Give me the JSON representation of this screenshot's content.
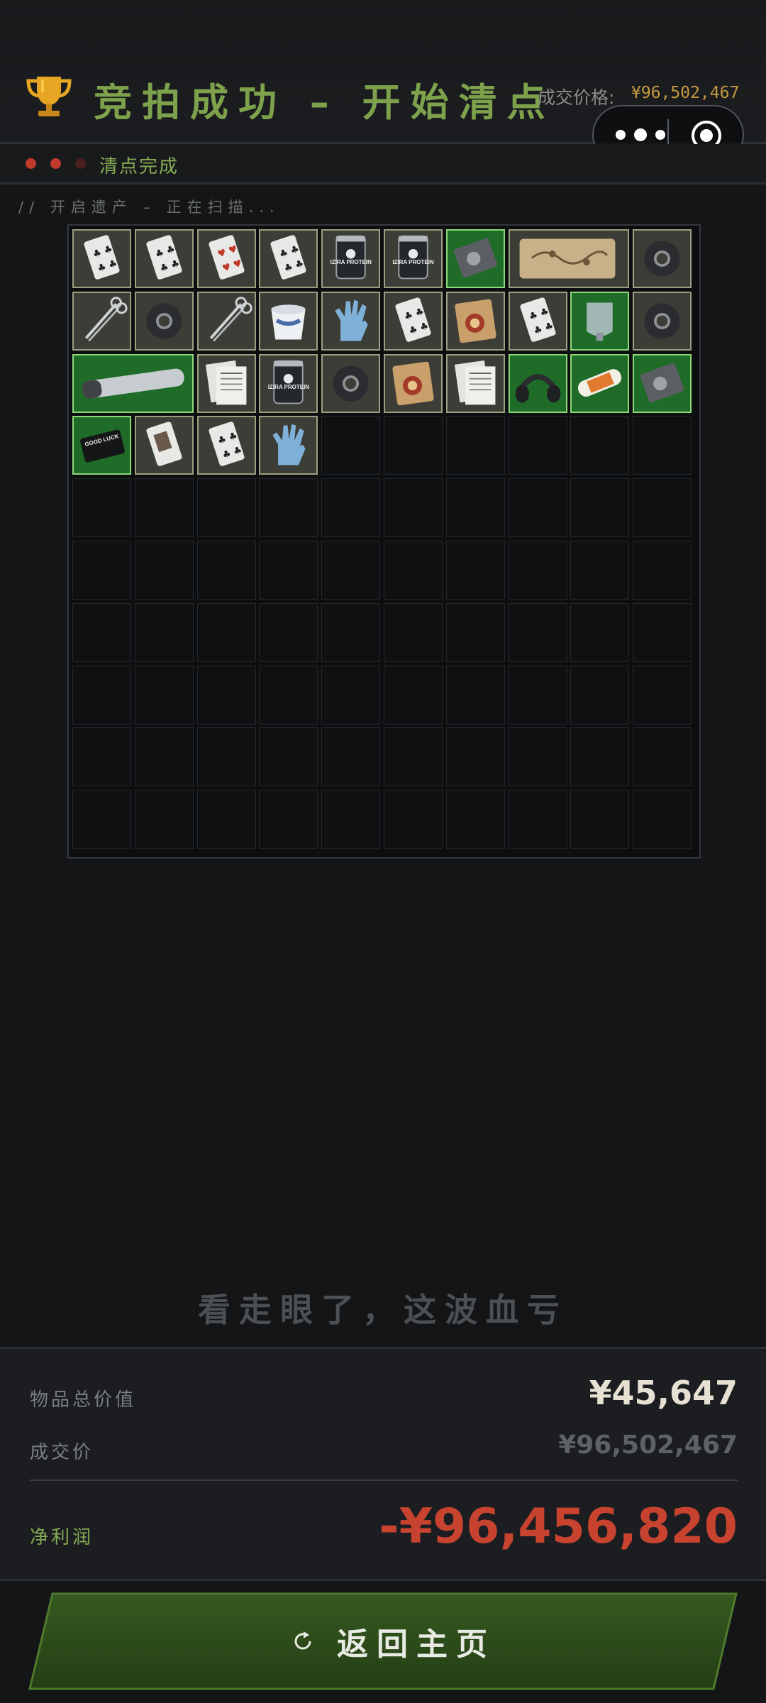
{
  "header": {
    "title": "竞拍成功 – 开始清点",
    "price_label": "成交价格:",
    "price_value": "¥96,502,467"
  },
  "status": {
    "text": "清点完成",
    "dots": 3
  },
  "scan": {
    "text": "// 开启遗产 – 正在扫描..."
  },
  "inventory": {
    "columns": 10,
    "rows": 10,
    "items": [
      {
        "name": "playing-card-clubs",
        "label": "",
        "row": 0,
        "col": 0,
        "w": 1,
        "h": 1,
        "rarity": "grey"
      },
      {
        "name": "playing-card-clubs",
        "label": "",
        "row": 0,
        "col": 1,
        "w": 1,
        "h": 1,
        "rarity": "grey"
      },
      {
        "name": "playing-card-hearts",
        "label": "",
        "row": 0,
        "col": 2,
        "w": 1,
        "h": 1,
        "rarity": "grey"
      },
      {
        "name": "playing-card-clubs",
        "label": "",
        "row": 0,
        "col": 3,
        "w": 1,
        "h": 1,
        "rarity": "grey"
      },
      {
        "name": "protein-can",
        "label": "IZIRA PROTEIN",
        "row": 0,
        "col": 4,
        "w": 1,
        "h": 1,
        "rarity": "grey"
      },
      {
        "name": "protein-can",
        "label": "IZIRA PROTEIN",
        "row": 0,
        "col": 5,
        "w": 1,
        "h": 1,
        "rarity": "grey"
      },
      {
        "name": "hard-drive",
        "label": "",
        "row": 0,
        "col": 6,
        "w": 1,
        "h": 1,
        "rarity": "green"
      },
      {
        "name": "old-map",
        "label": "",
        "row": 0,
        "col": 7,
        "w": 2,
        "h": 1,
        "rarity": "grey"
      },
      {
        "name": "duct-tape",
        "label": "",
        "row": 0,
        "col": 9,
        "w": 1,
        "h": 1,
        "rarity": "grey"
      },
      {
        "name": "surgical-scissors",
        "label": "",
        "row": 1,
        "col": 0,
        "w": 1,
        "h": 1,
        "rarity": "grey"
      },
      {
        "name": "duct-tape",
        "label": "",
        "row": 1,
        "col": 1,
        "w": 1,
        "h": 1,
        "rarity": "grey"
      },
      {
        "name": "surgical-scissors",
        "label": "",
        "row": 1,
        "col": 2,
        "w": 1,
        "h": 1,
        "rarity": "grey"
      },
      {
        "name": "yogurt-cup",
        "label": "",
        "row": 1,
        "col": 3,
        "w": 1,
        "h": 1,
        "rarity": "grey"
      },
      {
        "name": "medical-glove",
        "label": "",
        "row": 1,
        "col": 4,
        "w": 1,
        "h": 1,
        "rarity": "grey"
      },
      {
        "name": "playing-card-clubs",
        "label": "",
        "row": 1,
        "col": 5,
        "w": 1,
        "h": 1,
        "rarity": "grey"
      },
      {
        "name": "instant-noodles",
        "label": "",
        "row": 1,
        "col": 6,
        "w": 1,
        "h": 1,
        "rarity": "grey"
      },
      {
        "name": "playing-card-clubs",
        "label": "",
        "row": 1,
        "col": 7,
        "w": 1,
        "h": 1,
        "rarity": "grey"
      },
      {
        "name": "saline-bag",
        "label": "",
        "row": 1,
        "col": 8,
        "w": 1,
        "h": 1,
        "rarity": "green"
      },
      {
        "name": "duct-tape",
        "label": "",
        "row": 1,
        "col": 9,
        "w": 1,
        "h": 1,
        "rarity": "grey"
      },
      {
        "name": "glass-tube",
        "label": "",
        "row": 2,
        "col": 0,
        "w": 2,
        "h": 1,
        "rarity": "green"
      },
      {
        "name": "newspaper",
        "label": "",
        "row": 2,
        "col": 2,
        "w": 1,
        "h": 1,
        "rarity": "grey"
      },
      {
        "name": "protein-can",
        "label": "IZIRA PROTEIN",
        "row": 2,
        "col": 3,
        "w": 1,
        "h": 1,
        "rarity": "grey"
      },
      {
        "name": "duct-tape",
        "label": "",
        "row": 2,
        "col": 4,
        "w": 1,
        "h": 1,
        "rarity": "grey"
      },
      {
        "name": "instant-noodles",
        "label": "",
        "row": 2,
        "col": 5,
        "w": 1,
        "h": 1,
        "rarity": "grey"
      },
      {
        "name": "newspaper",
        "label": "",
        "row": 2,
        "col": 6,
        "w": 1,
        "h": 1,
        "rarity": "grey"
      },
      {
        "name": "military-headset",
        "label": "",
        "row": 2,
        "col": 7,
        "w": 1,
        "h": 1,
        "rarity": "green"
      },
      {
        "name": "cookie-roll",
        "label": "",
        "row": 2,
        "col": 8,
        "w": 1,
        "h": 1,
        "rarity": "green"
      },
      {
        "name": "hard-drive",
        "label": "",
        "row": 2,
        "col": 9,
        "w": 1,
        "h": 1,
        "rarity": "green"
      },
      {
        "name": "good-luck-card",
        "label": "GOOD LUCK",
        "row": 3,
        "col": 0,
        "w": 1,
        "h": 1,
        "rarity": "green"
      },
      {
        "name": "playing-card-portrait",
        "label": "",
        "row": 3,
        "col": 1,
        "w": 1,
        "h": 1,
        "rarity": "grey"
      },
      {
        "name": "playing-card-clubs",
        "label": "",
        "row": 3,
        "col": 2,
        "w": 1,
        "h": 1,
        "rarity": "grey"
      },
      {
        "name": "medical-glove",
        "label": "",
        "row": 3,
        "col": 3,
        "w": 1,
        "h": 1,
        "rarity": "grey"
      }
    ]
  },
  "verdict": "看走眼了，这波血亏",
  "summary": {
    "total_value_label": "物品总价值",
    "total_value": "¥45,647",
    "deal_price_label": "成交价",
    "deal_price": "¥96,502,467",
    "net_profit_label": "净利润",
    "net_profit": "-¥96,456,820"
  },
  "home_button": {
    "label": "返回主页",
    "icon": "refresh-icon"
  },
  "colors": {
    "accent_green": "#7ea24c",
    "price_gold": "#c39a3f",
    "loss_red": "#c8432f",
    "rarity_green": "#1f6b28",
    "rarity_grey": "#3b3d36"
  }
}
